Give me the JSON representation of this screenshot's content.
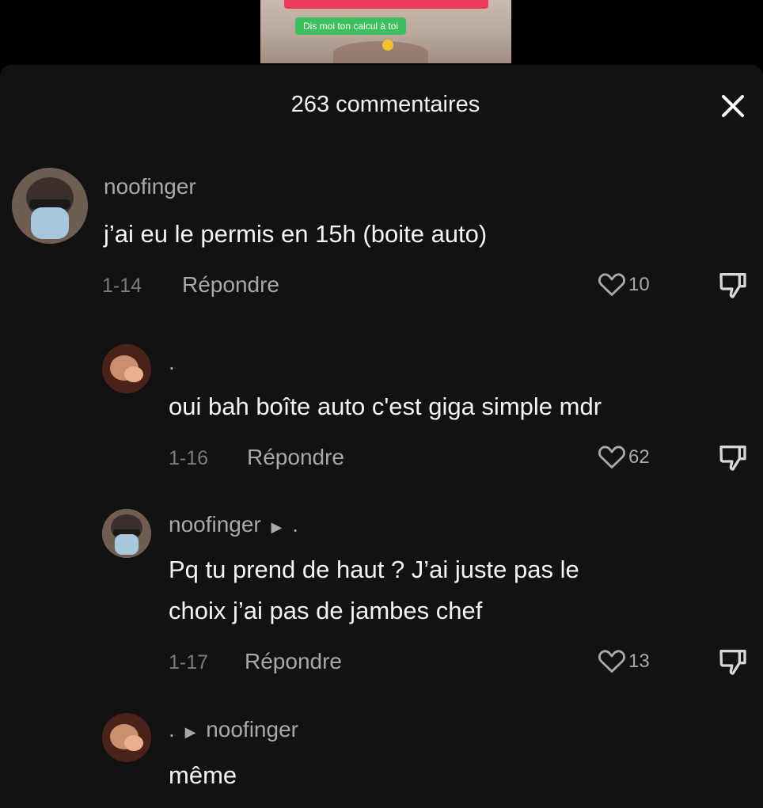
{
  "video_preview": {
    "caption": "Dis moi ton calcul à toi"
  },
  "header": {
    "title": "263 commentaires"
  },
  "comments": [
    {
      "username": "noofinger",
      "text": "j’ai eu le permis en 15h (boite auto)",
      "date": "1-14",
      "reply_label": "Répondre",
      "likes": "10"
    },
    {
      "username": ".",
      "text": "oui bah boîte auto c'est giga simple mdr",
      "date": "1-16",
      "reply_label": "Répondre",
      "likes": "62"
    },
    {
      "username": "noofinger",
      "reply_to": ".",
      "text_lines": [
        "Pq tu prend de haut ? J’ai juste pas le",
        "choix j’ai pas de jambes chef"
      ],
      "date": "1-17",
      "reply_label": "Répondre",
      "likes": "13"
    },
    {
      "username": ".",
      "reply_to": "noofinger",
      "text": "même"
    }
  ],
  "icons": {
    "close": "close-icon",
    "like": "heart-icon",
    "dislike": "thumbs-down-icon",
    "reply_arrow": "play-arrow-icon"
  }
}
